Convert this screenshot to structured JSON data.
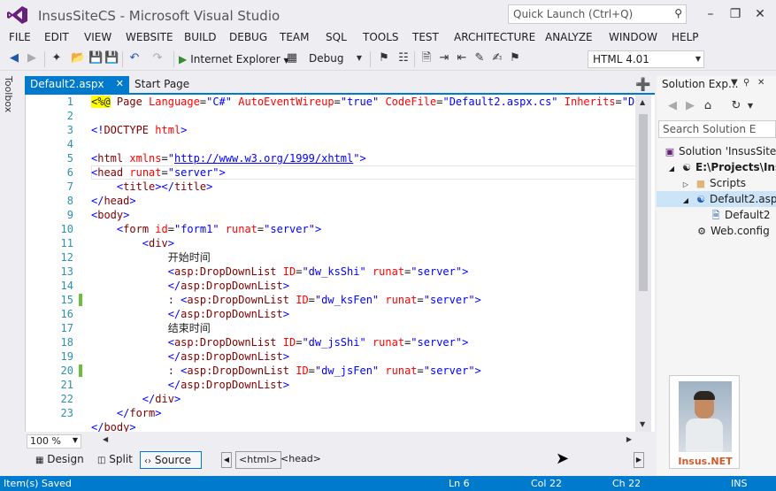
{
  "app": {
    "title": "InsusSiteCS - Microsoft Visual Studio",
    "quick_launch_placeholder": "Quick Launch (Ctrl+Q)"
  },
  "menu": [
    "FILE",
    "EDIT",
    "VIEW",
    "WEBSITE",
    "BUILD",
    "DEBUG",
    "TEAM",
    "SQL",
    "TOOLS",
    "TEST",
    "ARCHITECTURE",
    "ANALYZE",
    "WINDOW",
    "HELP"
  ],
  "toolbar": {
    "run_target": "Internet Explorer",
    "configuration": "Debug",
    "doc_type": "HTML 4.01"
  },
  "toolbox": {
    "label": "Toolbox"
  },
  "tabs": {
    "active": "Default2.aspx",
    "other": "Start Page"
  },
  "editor": {
    "line_numbers": [
      "1",
      "2",
      "3",
      "4",
      "5",
      "6",
      "7",
      "8",
      "9",
      "10",
      "11",
      "12",
      "13",
      "14",
      "15",
      "16",
      "17",
      "18",
      "19",
      "20",
      "21",
      "22",
      "23"
    ],
    "changed_lines": [
      15,
      20
    ],
    "zoom": "100 %"
  },
  "view_bar": {
    "design": "Design",
    "split": "Split",
    "source": "Source",
    "crumbs": [
      "<html>",
      "<head>"
    ]
  },
  "solution_explorer": {
    "title": "Solution Exp...",
    "search_placeholder": "Search Solution E",
    "items": [
      "Solution 'InsusSite",
      "E:\\Projects\\Ins",
      "Scripts",
      "Default2.asp",
      "Default2",
      "Web.config"
    ]
  },
  "photo": {
    "caption": "Insus.NET"
  },
  "status": {
    "message": "Item(s) Saved",
    "ln": "Ln 6",
    "col": "Col 22",
    "ch": "Ch 22",
    "mode": "INS"
  },
  "colors": {
    "accent": "#007acc",
    "tag": "#800000",
    "attribute": "#ff0000",
    "value": "#0000ff",
    "line_number": "#2b91af",
    "change_marker": "#6abf40"
  }
}
